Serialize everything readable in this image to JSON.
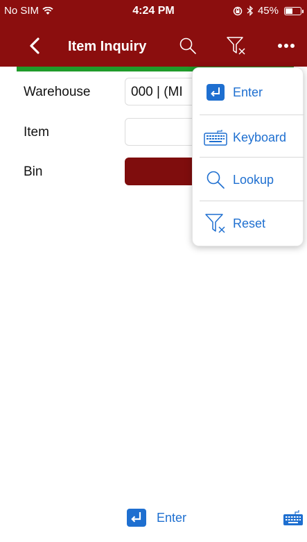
{
  "status_bar": {
    "carrier": "No SIM",
    "time": "4:24 PM",
    "battery": "45%",
    "battery_level": 0.45
  },
  "nav": {
    "title": "Item Inquiry"
  },
  "form": {
    "warehouse_label": "Warehouse",
    "warehouse_value": "000 | (MI",
    "item_label": "Item",
    "item_value": "",
    "bin_label": "Bin"
  },
  "menu": {
    "items": [
      {
        "label": "Enter",
        "icon": "enter-icon"
      },
      {
        "label": "Keyboard",
        "icon": "keyboard-icon"
      },
      {
        "label": "Lookup",
        "icon": "search-icon"
      },
      {
        "label": "Reset",
        "icon": "filter-reset-icon"
      }
    ]
  },
  "toolbar": {
    "enter_label": "Enter"
  },
  "colors": {
    "brand": "#8b0e0e",
    "accent": "#1e6fd0",
    "strip": "#1f9b2a"
  }
}
